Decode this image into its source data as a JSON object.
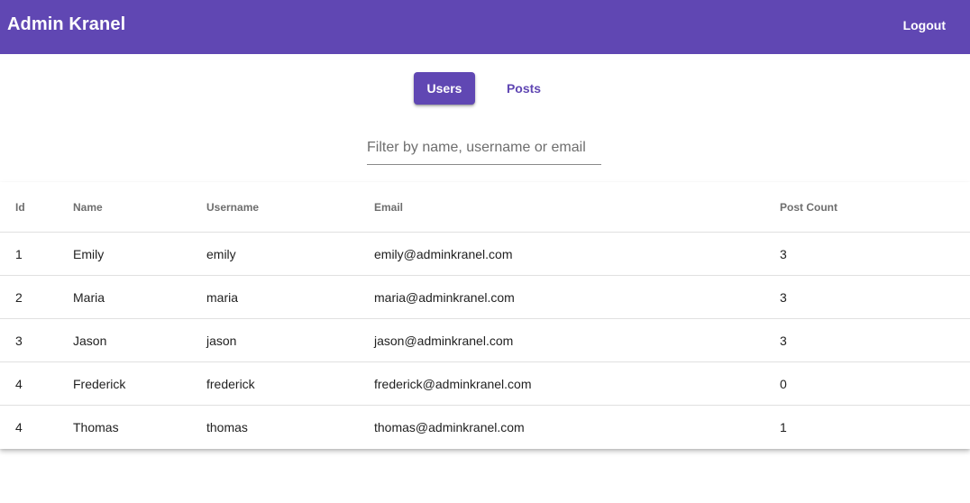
{
  "app": {
    "title": "Admin Kranel",
    "logout_label": "Logout",
    "accent_color": "#6047b3"
  },
  "tabs": [
    {
      "label": "Users",
      "active": true
    },
    {
      "label": "Posts",
      "active": false
    }
  ],
  "filter": {
    "placeholder": "Filter by name, username or email",
    "value": ""
  },
  "table": {
    "headers": [
      "Id",
      "Name",
      "Username",
      "Email",
      "Post Count"
    ],
    "rows": [
      {
        "id": "1",
        "name": "Emily",
        "username": "emily",
        "email": "emily@adminkranel.com",
        "post_count": "3"
      },
      {
        "id": "2",
        "name": "Maria",
        "username": "maria",
        "email": "maria@adminkranel.com",
        "post_count": "3"
      },
      {
        "id": "3",
        "name": "Jason",
        "username": "jason",
        "email": "jason@adminkranel.com",
        "post_count": "3"
      },
      {
        "id": "4",
        "name": "Frederick",
        "username": "frederick",
        "email": "frederick@adminkranel.com",
        "post_count": "0"
      },
      {
        "id": "4",
        "name": "Thomas",
        "username": "thomas",
        "email": "thomas@adminkranel.com",
        "post_count": "1"
      }
    ]
  }
}
